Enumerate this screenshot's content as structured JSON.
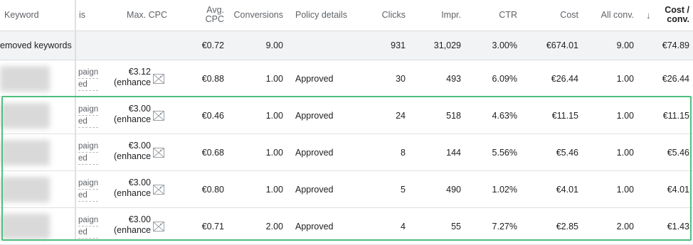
{
  "header": {
    "keyword": "Keyword",
    "campaign_partial": "is",
    "max_cpc": "Max. CPC",
    "avg_cpc_1": "Avg.",
    "avg_cpc_2": "CPC",
    "conversions": "Conversions",
    "policy": "Policy details",
    "clicks": "Clicks",
    "impr": "Impr.",
    "ctr": "CTR",
    "cost": "Cost",
    "all_conv": "All conv.",
    "sort_arrow": "↓",
    "cost_conv_1": "Cost /",
    "cost_conv_2": "conv."
  },
  "total": {
    "label": "emoved keywords",
    "avg_cpc": "€0.72",
    "conversions": "9.00",
    "clicks": "931",
    "impr": "31,029",
    "ctr": "3.00%",
    "cost": "€674.01",
    "all_conv": "9.00",
    "cost_conv": "€74.89"
  },
  "rows": [
    {
      "camp1": "paign",
      "camp2": "ed",
      "max_cpc": "€3.12",
      "enh": "(enhanced",
      "avg_cpc": "€0.88",
      "conversions": "1.00",
      "policy": "Approved",
      "clicks": "30",
      "impr": "493",
      "ctr": "6.09%",
      "cost": "€26.44",
      "all_conv": "1.00",
      "cost_conv": "€26.44"
    },
    {
      "camp1": "paign",
      "camp2": "ed",
      "max_cpc": "€3.00",
      "enh": "(enhanced",
      "avg_cpc": "€0.46",
      "conversions": "1.00",
      "policy": "Approved",
      "clicks": "24",
      "impr": "518",
      "ctr": "4.63%",
      "cost": "€11.15",
      "all_conv": "1.00",
      "cost_conv": "€11.15"
    },
    {
      "camp1": "paign",
      "camp2": "ed",
      "max_cpc": "€3.00",
      "enh": "(enhanced",
      "avg_cpc": "€0.68",
      "conversions": "1.00",
      "policy": "Approved",
      "clicks": "8",
      "impr": "144",
      "ctr": "5.56%",
      "cost": "€5.46",
      "all_conv": "1.00",
      "cost_conv": "€5.46"
    },
    {
      "camp1": "paign",
      "camp2": "ed",
      "max_cpc": "€3.00",
      "enh": "(enhanced",
      "avg_cpc": "€0.80",
      "conversions": "1.00",
      "policy": "Approved",
      "clicks": "5",
      "impr": "490",
      "ctr": "1.02%",
      "cost": "€4.01",
      "all_conv": "1.00",
      "cost_conv": "€4.01"
    },
    {
      "camp1": "paign",
      "camp2": "ed",
      "max_cpc": "€3.00",
      "enh": "(enhanced",
      "avg_cpc": "€0.71",
      "conversions": "2.00",
      "policy": "Approved",
      "clicks": "4",
      "impr": "55",
      "ctr": "7.27%",
      "cost": "€2.85",
      "all_conv": "2.00",
      "cost_conv": "€1.43"
    }
  ]
}
